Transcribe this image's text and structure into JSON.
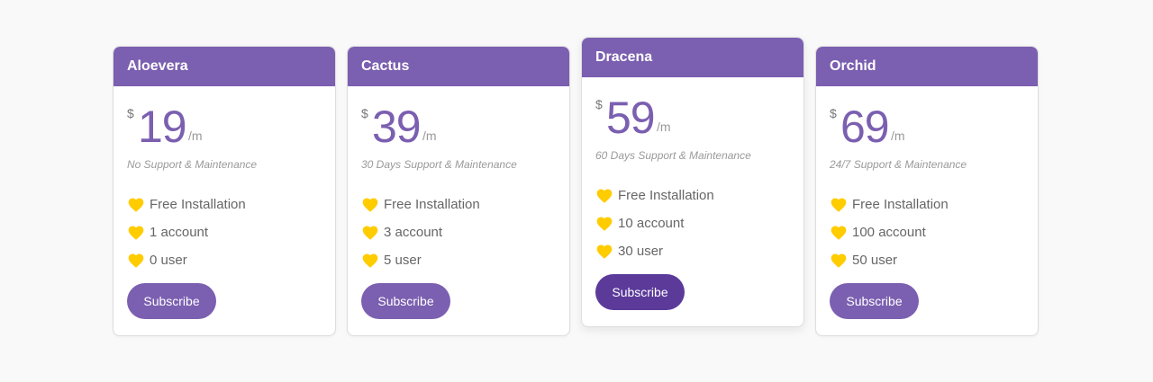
{
  "colors": {
    "header": "#7b5fb0",
    "price": "#7b5fb0",
    "button": "#7b5fb0",
    "button_featured": "#5b3a9a",
    "heart": "#ffcc00"
  },
  "icon": "heart-icon",
  "plans": [
    {
      "name": "Aloevera",
      "currency": "$",
      "price": "19",
      "period": "/m",
      "support": "No Support & Maintenance",
      "features": [
        "Free Installation",
        "1 account",
        "0 user"
      ],
      "button": "Subscribe",
      "featured": false
    },
    {
      "name": "Cactus",
      "currency": "$",
      "price": "39",
      "period": "/m",
      "support": "30 Days Support & Maintenance",
      "features": [
        "Free Installation",
        "3 account",
        "5 user"
      ],
      "button": "Subscribe",
      "featured": false
    },
    {
      "name": "Dracena",
      "currency": "$",
      "price": "59",
      "period": "/m",
      "support": "60 Days Support & Maintenance",
      "features": [
        "Free Installation",
        "10 account",
        "30 user"
      ],
      "button": "Subscribe",
      "featured": true
    },
    {
      "name": "Orchid",
      "currency": "$",
      "price": "69",
      "period": "/m",
      "support": "24/7 Support & Maintenance",
      "features": [
        "Free Installation",
        "100 account",
        "50 user"
      ],
      "button": "Subscribe",
      "featured": false
    }
  ]
}
